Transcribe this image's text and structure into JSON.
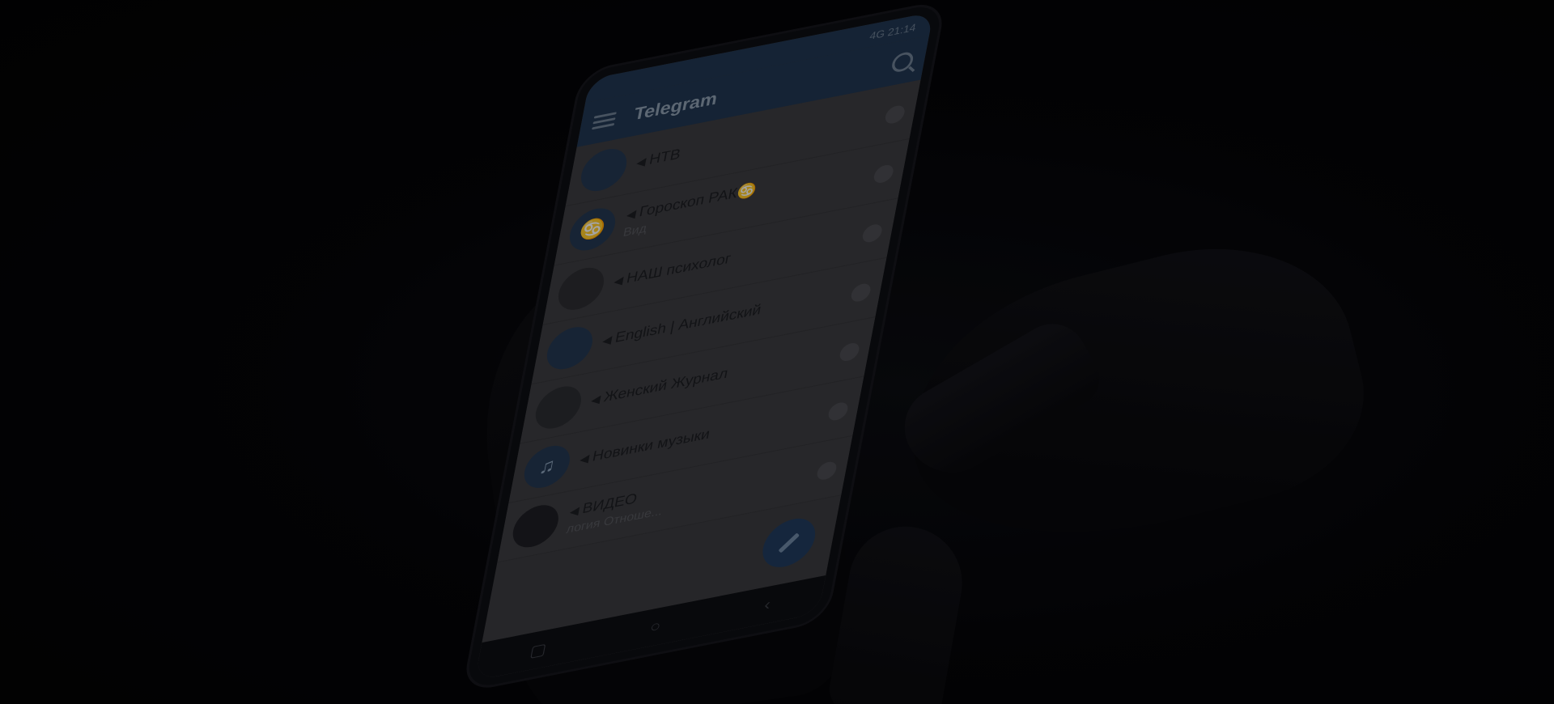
{
  "status_bar": {
    "text": "4G 21:14"
  },
  "app": {
    "title": "Telegram"
  },
  "chats": [
    {
      "name": "НТВ",
      "preview": "",
      "avatar_icon": "ntv-avatar"
    },
    {
      "name": "Гороскоп РАК♋",
      "preview": "Вид",
      "avatar_icon": "crab-avatar"
    },
    {
      "name": "НАШ психолог",
      "preview": "",
      "avatar_icon": "psychologist-avatar"
    },
    {
      "name": "English | Английский",
      "preview": "",
      "avatar_icon": "english-avatar"
    },
    {
      "name": "Женский Журнал",
      "preview": "",
      "avatar_icon": "journal-avatar"
    },
    {
      "name": "Новинки музыки",
      "preview": "",
      "avatar_icon": "music-avatar"
    },
    {
      "name": "ВИДЕО",
      "preview": "",
      "avatar_icon": "video-avatar"
    }
  ],
  "footer_snippet": "логия Отноше...",
  "colors": {
    "app_bar": "#1f3550",
    "screen": "#3a3a3e",
    "background": "#030305"
  }
}
